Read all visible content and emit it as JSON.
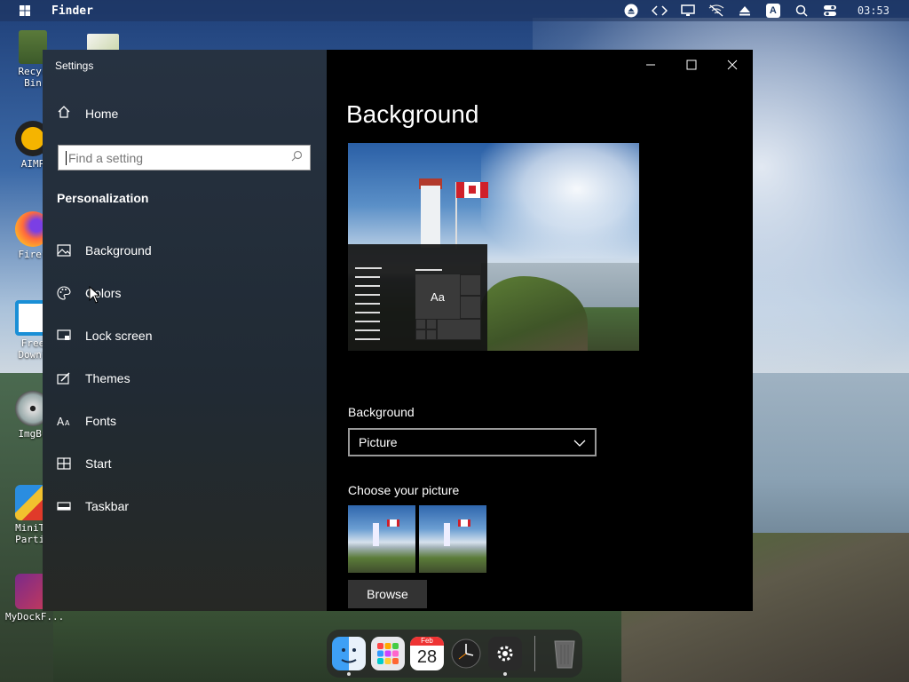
{
  "menubar": {
    "app_name": "Finder",
    "clock": "03:53",
    "tray_icons": [
      "eject-icon",
      "code-icon",
      "monitor-icon",
      "network-off-icon",
      "upload-icon",
      "input-method-icon",
      "search-icon",
      "toggle-icon"
    ],
    "input_method_letter": "A"
  },
  "desktop": {
    "icons": [
      {
        "name": "recycle-bin",
        "label_line1": "Recyc",
        "label_line2": "Bin"
      },
      {
        "name": "aimp",
        "label_line1": "AIMP",
        "label_line2": ""
      },
      {
        "name": "firefox",
        "label_line1": "Firef",
        "label_line2": ""
      },
      {
        "name": "free-download",
        "label_line1": "Free",
        "label_line2": "Downl"
      },
      {
        "name": "imgburn",
        "label_line1": "ImgBu",
        "label_line2": ""
      },
      {
        "name": "minitool-partition",
        "label_line1": "MiniTo",
        "label_line2": "Partit"
      },
      {
        "name": "mydockfinder",
        "label_line1": "MyDockF...",
        "label_line2": ""
      }
    ]
  },
  "window": {
    "title": "Settings",
    "controls": {
      "minimize": "—",
      "maximize": "☐",
      "close": "✕"
    }
  },
  "nav": {
    "home": "Home",
    "search_placeholder": "Find a setting",
    "section_title": "Personalization",
    "items": [
      {
        "label": "Background",
        "icon": "picture-icon"
      },
      {
        "label": "Colors",
        "icon": "palette-icon"
      },
      {
        "label": "Lock screen",
        "icon": "lock-screen-icon"
      },
      {
        "label": "Themes",
        "icon": "themes-icon"
      },
      {
        "label": "Fonts",
        "icon": "fonts-icon"
      },
      {
        "label": "Start",
        "icon": "start-icon"
      },
      {
        "label": "Taskbar",
        "icon": "taskbar-icon"
      }
    ]
  },
  "content": {
    "page_title": "Background",
    "preview_tile_text": "Aa",
    "background_label": "Background",
    "background_value": "Picture",
    "choose_label": "Choose your picture",
    "browse_label": "Browse"
  },
  "dock": {
    "calendar_month": "Feb",
    "calendar_day": "28",
    "items": [
      "finder-icon",
      "launchpad-icon",
      "calendar-icon",
      "clock-icon",
      "settings-icon",
      "trash-icon"
    ]
  }
}
